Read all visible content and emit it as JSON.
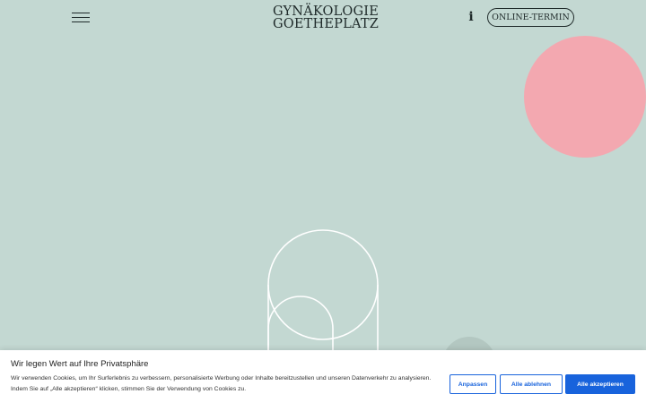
{
  "header": {
    "logo_line1": "GYNÄKOLOGIE",
    "logo_line2": "GOETHEPLATZ",
    "info_glyph": "i",
    "cta_label": "ONLINE-TERMIN",
    "menu_icon": "hamburger-menu-icon"
  },
  "decor": {
    "pink_circle_color": "#f3a8b0",
    "background_color": "#c3d8d2"
  },
  "cookie_banner": {
    "title": "Wir legen Wert auf Ihre Privatsphäre",
    "text": "Wir verwenden Cookies, um Ihr Surferlebnis zu verbessern, personalisierte Werbung oder Inhalte bereitzustellen und unseren Datenverkehr zu analysieren. Indem Sie auf „Alle akzeptieren“ klicken, stimmen Sie der Verwendung von Cookies zu.",
    "customize_label": "Anpassen",
    "reject_label": "Alle ablehnen",
    "accept_label": "Alle akzeptieren",
    "accent_color": "#1863dc"
  }
}
